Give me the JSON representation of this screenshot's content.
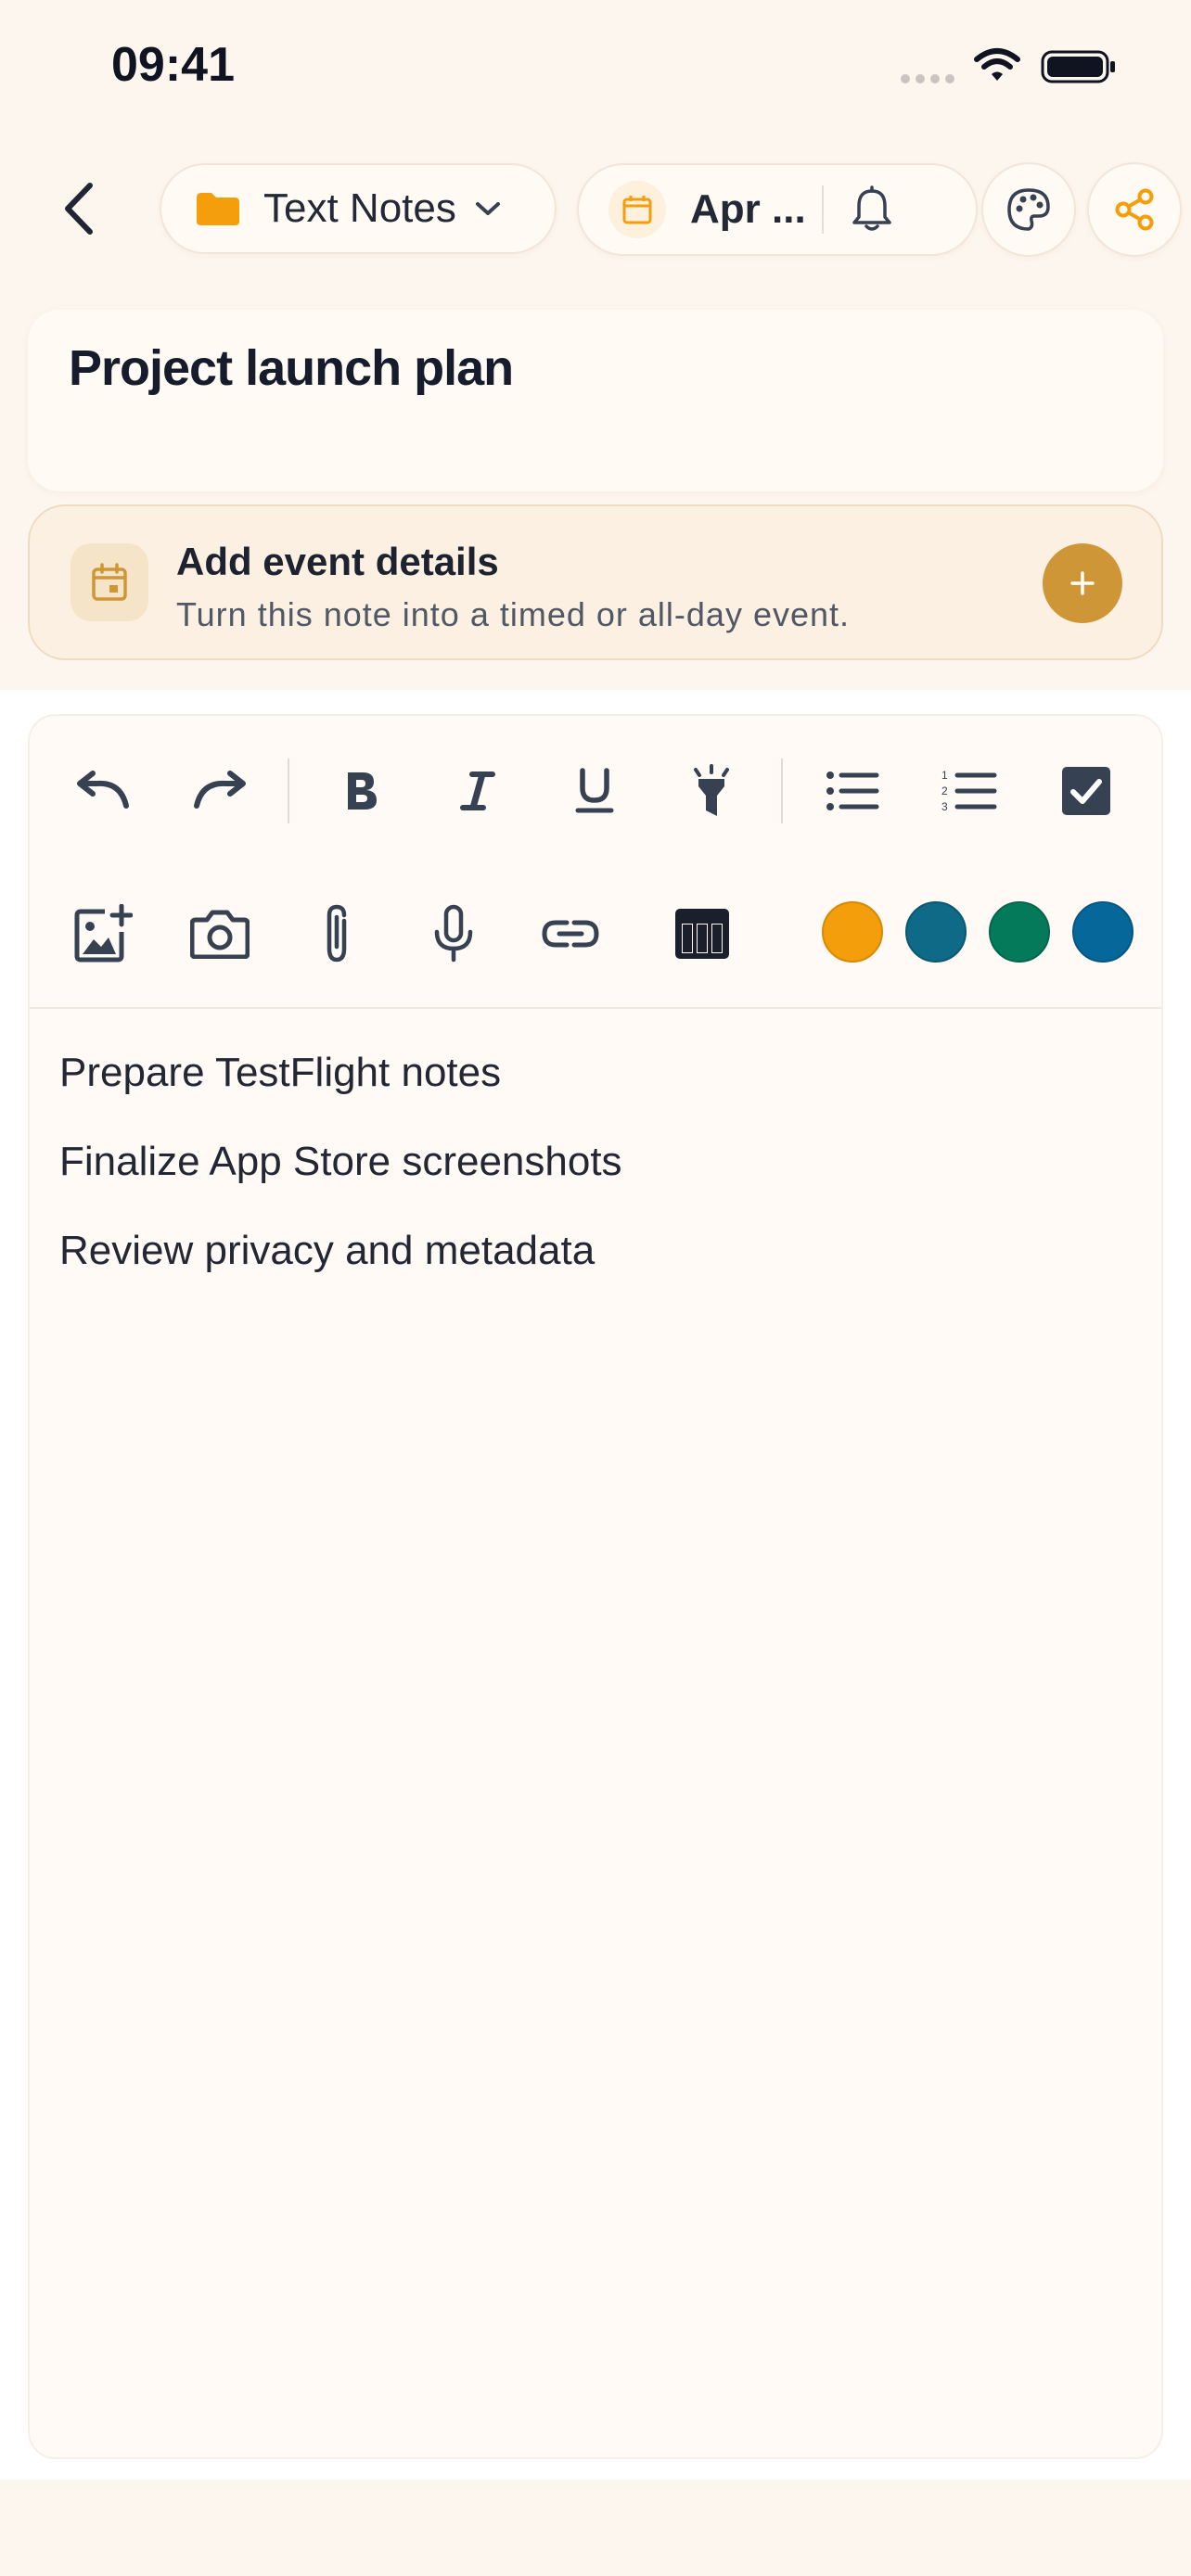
{
  "status_bar": {
    "time": "09:41"
  },
  "header": {
    "folder_label": "Text Notes",
    "date_label": "Apr ..."
  },
  "note": {
    "title": "Project launch plan"
  },
  "event_card": {
    "title": "Add event details",
    "subtitle": "Turn this note into a timed or all-day event."
  },
  "toolbar": {
    "icons_row1": [
      "undo-icon",
      "redo-icon",
      "bold-icon",
      "italic-icon",
      "underline-icon",
      "highlighter-icon",
      "bullet-list-icon",
      "numbered-list-icon",
      "checkbox-icon"
    ],
    "icons_row2": [
      "add-image-icon",
      "camera-icon",
      "paperclip-icon",
      "microphone-icon",
      "link-icon",
      "table-icon"
    ],
    "color_swatches": [
      "#f59e0b",
      "#0e6a86",
      "#047a5b",
      "#06689a"
    ]
  },
  "body_lines": [
    "Prepare TestFlight notes",
    "Finalize App Store screenshots",
    "Review privacy and metadata"
  ],
  "colors": {
    "background": "#fdf6ef",
    "accent": "#f59e0b",
    "accent_dark": "#cf9637",
    "icon": "#364152"
  }
}
